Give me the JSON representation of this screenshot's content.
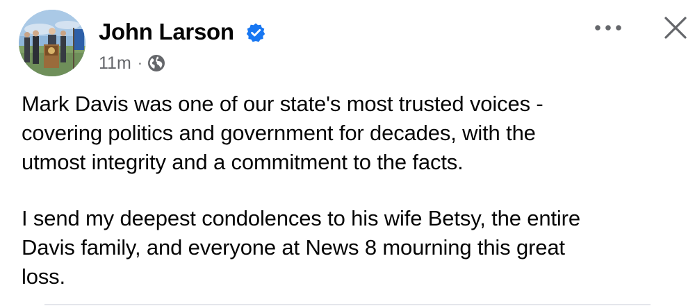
{
  "post": {
    "author": {
      "name": "John Larson",
      "verified": true,
      "avatar_icon": "avatar-photo-podium"
    },
    "meta": {
      "timestamp": "11m",
      "separator": "·",
      "audience_icon": "globe-icon"
    },
    "header_actions": {
      "more_icon": "ellipsis-icon",
      "close_icon": "close-icon"
    },
    "body": {
      "paragraphs": [
        "Mark Davis was one of our state's most trusted voices -\ncovering politics and government for decades, with the\nutmost integrity and a commitment to the facts.",
        "I send my deepest condolences to his wife Betsy, the entire\nDavis family, and everyone at News 8 mourning this great\nloss."
      ]
    }
  },
  "colors": {
    "text_primary": "#050505",
    "text_secondary": "#65676b",
    "verified_badge": "#1877f2",
    "divider": "#e4e6eb"
  }
}
